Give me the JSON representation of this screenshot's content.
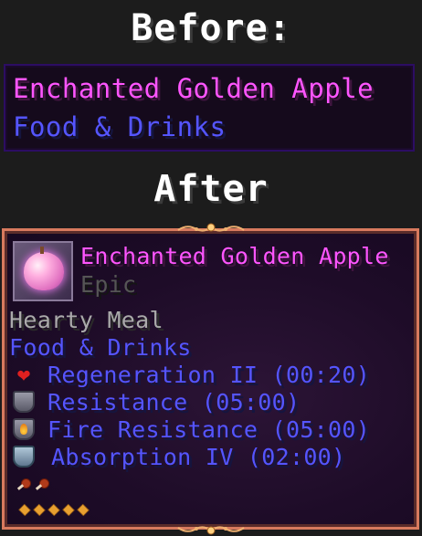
{
  "headings": {
    "before": "Before:",
    "after": "After"
  },
  "before_tooltip": {
    "item_name": "Enchanted Golden Apple",
    "category": "Food & Drinks"
  },
  "after_tooltip": {
    "item_name": "Enchanted Golden Apple",
    "rarity": "Epic",
    "description": "Hearty Meal",
    "category": "Food & Drinks",
    "effects": [
      {
        "icon": "heart-icon",
        "text": "Regeneration II (00:20)"
      },
      {
        "icon": "resistance-shield-icon",
        "text": "Resistance (05:00)"
      },
      {
        "icon": "fire-resistance-icon",
        "text": "Fire Resistance (05:00)"
      },
      {
        "icon": "absorption-shield-icon",
        "text": "Absorption IV (02:00)"
      }
    ],
    "hunger_icons": 2,
    "saturation_icons": 5
  },
  "colors": {
    "name_pink": "#ff55ff",
    "category_blue": "#5555ff",
    "description_gray": "#aaaaaa",
    "rarity_gray": "#555555",
    "border_gold": "#d87a5e"
  }
}
